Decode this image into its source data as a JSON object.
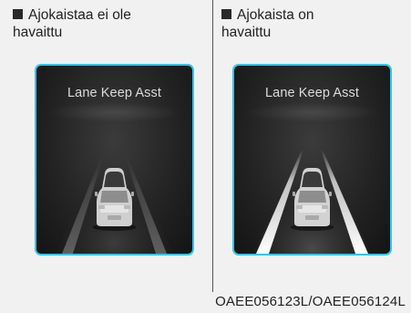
{
  "panels": [
    {
      "caption_line1": "Ajokaistaa ei ole",
      "caption_line2": "havaittu",
      "screen_title": "Lane Keep Asst",
      "lanes_detected": false
    },
    {
      "caption_line1": "Ajokaista on",
      "caption_line2": "havaittu",
      "screen_title": "Lane Keep Asst",
      "lanes_detected": true
    }
  ],
  "figure_code": "OAEE056123L/OAEE056124L",
  "colors": {
    "screen_border": "#2dc6f0",
    "screen_bg": "#222222",
    "lane_undetected": "#555555",
    "lane_detected": "#f4f4f4"
  }
}
